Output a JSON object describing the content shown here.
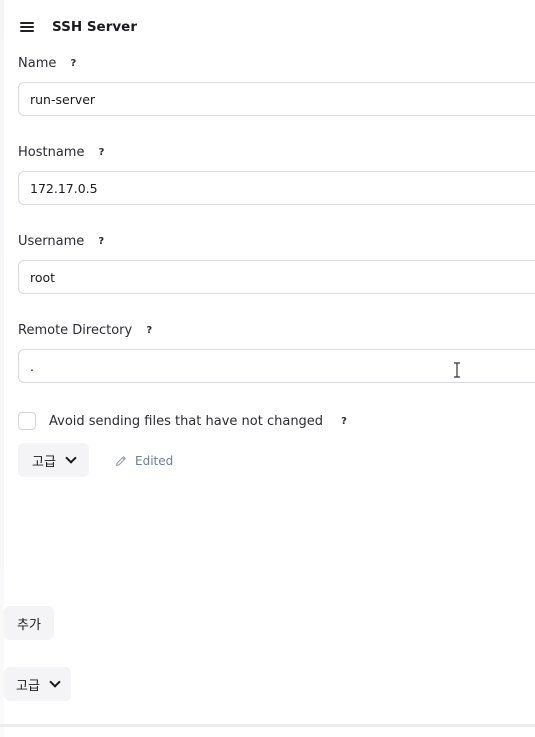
{
  "header": {
    "title": "SSH Server",
    "drag_icon": "hamburger-drag-icon"
  },
  "fields": {
    "name": {
      "label": "Name",
      "help": "?",
      "value": "run-server"
    },
    "hostname": {
      "label": "Hostname",
      "help": "?",
      "value": "172.17.0.5"
    },
    "username": {
      "label": "Username",
      "help": "?",
      "value": "root"
    },
    "remote_directory": {
      "label": "Remote Directory",
      "help": "?",
      "value": "."
    }
  },
  "avoid_sending": {
    "label": "Avoid sending files that have not changed",
    "help": "?",
    "checked": false
  },
  "advanced": {
    "label": "고급",
    "edited_label": "Edited"
  },
  "add_button": {
    "label": "추가"
  },
  "outer_advanced": {
    "label": "고급"
  },
  "colors": {
    "edited_text": "#6f7d9a",
    "button_bg": "#f4f4f6",
    "input_border": "#d9d9de"
  }
}
